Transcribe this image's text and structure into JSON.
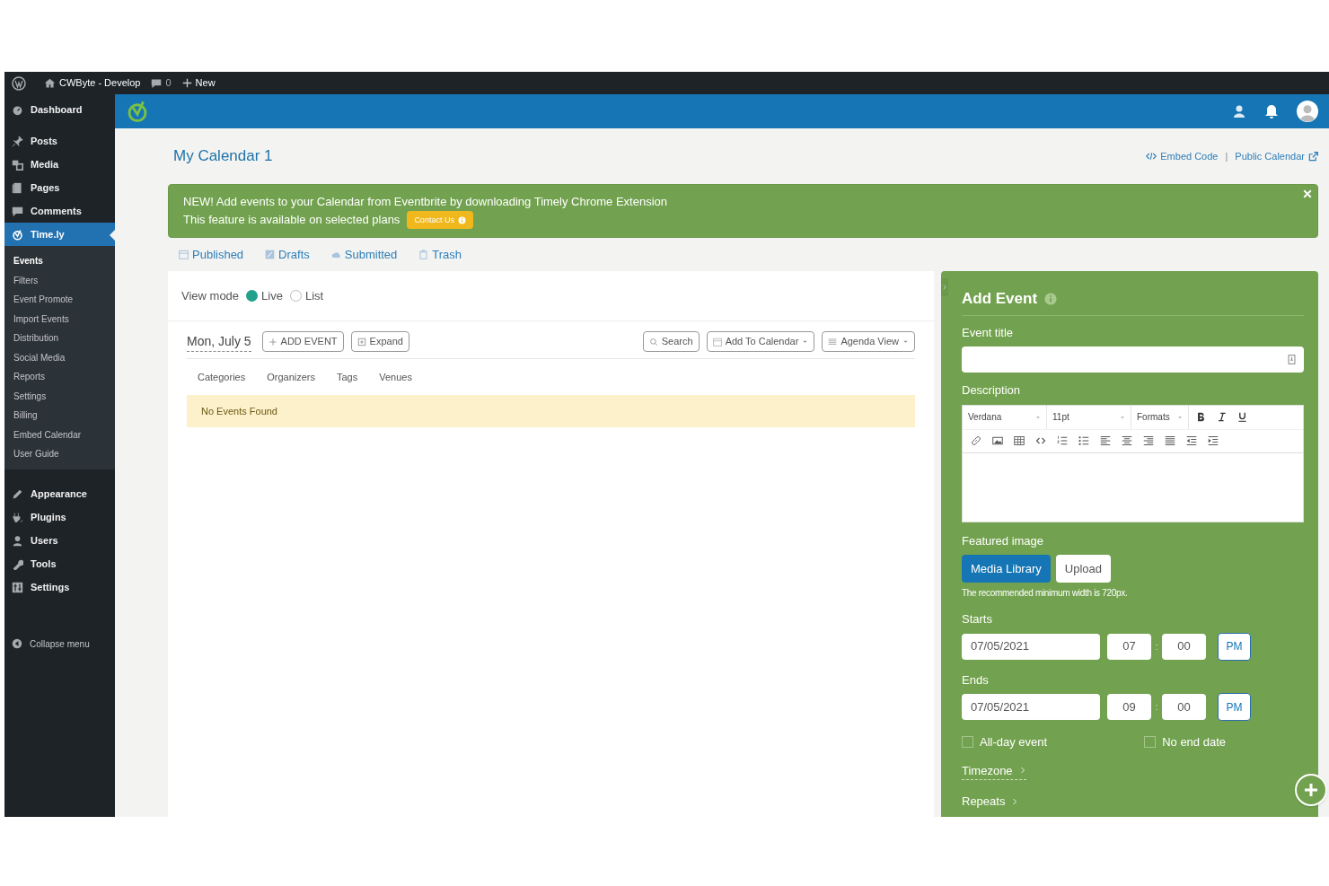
{
  "admin_bar": {
    "site": "CWByte - Develop",
    "comments": "0",
    "new": "New"
  },
  "sidebar": {
    "items": [
      {
        "label": "Dashboard",
        "selected": false
      },
      {
        "label": "Posts",
        "selected": false
      },
      {
        "label": "Media",
        "selected": false
      },
      {
        "label": "Pages",
        "selected": false
      },
      {
        "label": "Comments",
        "selected": false
      },
      {
        "label": "Time.ly",
        "selected": true,
        "children": [
          {
            "label": "Events",
            "selected": true
          },
          {
            "label": "Filters",
            "selected": false
          },
          {
            "label": "Event Promote",
            "selected": false
          },
          {
            "label": "Import Events",
            "selected": false
          },
          {
            "label": "Distribution",
            "selected": false
          },
          {
            "label": "Social Media",
            "selected": false
          },
          {
            "label": "Reports",
            "selected": false
          },
          {
            "label": "Settings",
            "selected": false
          },
          {
            "label": "Billing",
            "selected": false
          },
          {
            "label": "Embed Calendar",
            "selected": false
          },
          {
            "label": "User Guide",
            "selected": false
          }
        ]
      },
      {
        "label": "Appearance",
        "selected": false
      },
      {
        "label": "Plugins",
        "selected": false
      },
      {
        "label": "Users",
        "selected": false
      },
      {
        "label": "Tools",
        "selected": false
      },
      {
        "label": "Settings",
        "selected": false
      }
    ],
    "collapse": "Collapse menu"
  },
  "page": {
    "title": "My Calendar 1",
    "links": [
      "Embed Code",
      "Public Calendar"
    ],
    "link_separator": "|"
  },
  "notice": {
    "lines": [
      "NEW! Add events to your Calendar from Eventbrite by downloading Timely Chrome Extension",
      "This feature is available on selected plans"
    ],
    "button": "Contact Us"
  },
  "tabs": [
    "Published",
    "Drafts",
    "Submitted",
    "Trash"
  ],
  "view_mode": {
    "label": "View mode",
    "options": [
      {
        "label": "Live",
        "selected": true
      },
      {
        "label": "List",
        "selected": false
      }
    ]
  },
  "toolbar": {
    "date": "Mon, July 5",
    "left_buttons": [
      "ADD EVENT",
      "Expand"
    ],
    "right_buttons": [
      "Search",
      "Add To Calendar",
      "Agenda View"
    ]
  },
  "filters": [
    "Categories",
    "Organizers",
    "Tags",
    "Venues"
  ],
  "empty_message": "No Events Found",
  "add_event": {
    "title": "Add Event",
    "event_title_label": "Event title",
    "description_label": "Description",
    "editor": {
      "font": "Verdana",
      "size": "11pt",
      "formats": "Formats"
    },
    "featured_image_label": "Featured image",
    "image_buttons": [
      {
        "label": "Media Library",
        "selected": true
      },
      {
        "label": "Upload",
        "selected": false
      }
    ],
    "image_hint": "The recommended minimum width is 720px.",
    "starts": {
      "label": "Starts",
      "date": "07/05/2021",
      "hour": "07",
      "separator": ":",
      "minute": "00",
      "period": "PM"
    },
    "ends": {
      "label": "Ends",
      "date": "07/05/2021",
      "hour": "09",
      "separator": ":",
      "minute": "00",
      "period": "PM"
    },
    "checkboxes": [
      {
        "label": "All-day event",
        "checked": false
      },
      {
        "label": "No end date",
        "checked": false
      }
    ],
    "links": [
      "Timezone",
      "Repeats"
    ]
  }
}
